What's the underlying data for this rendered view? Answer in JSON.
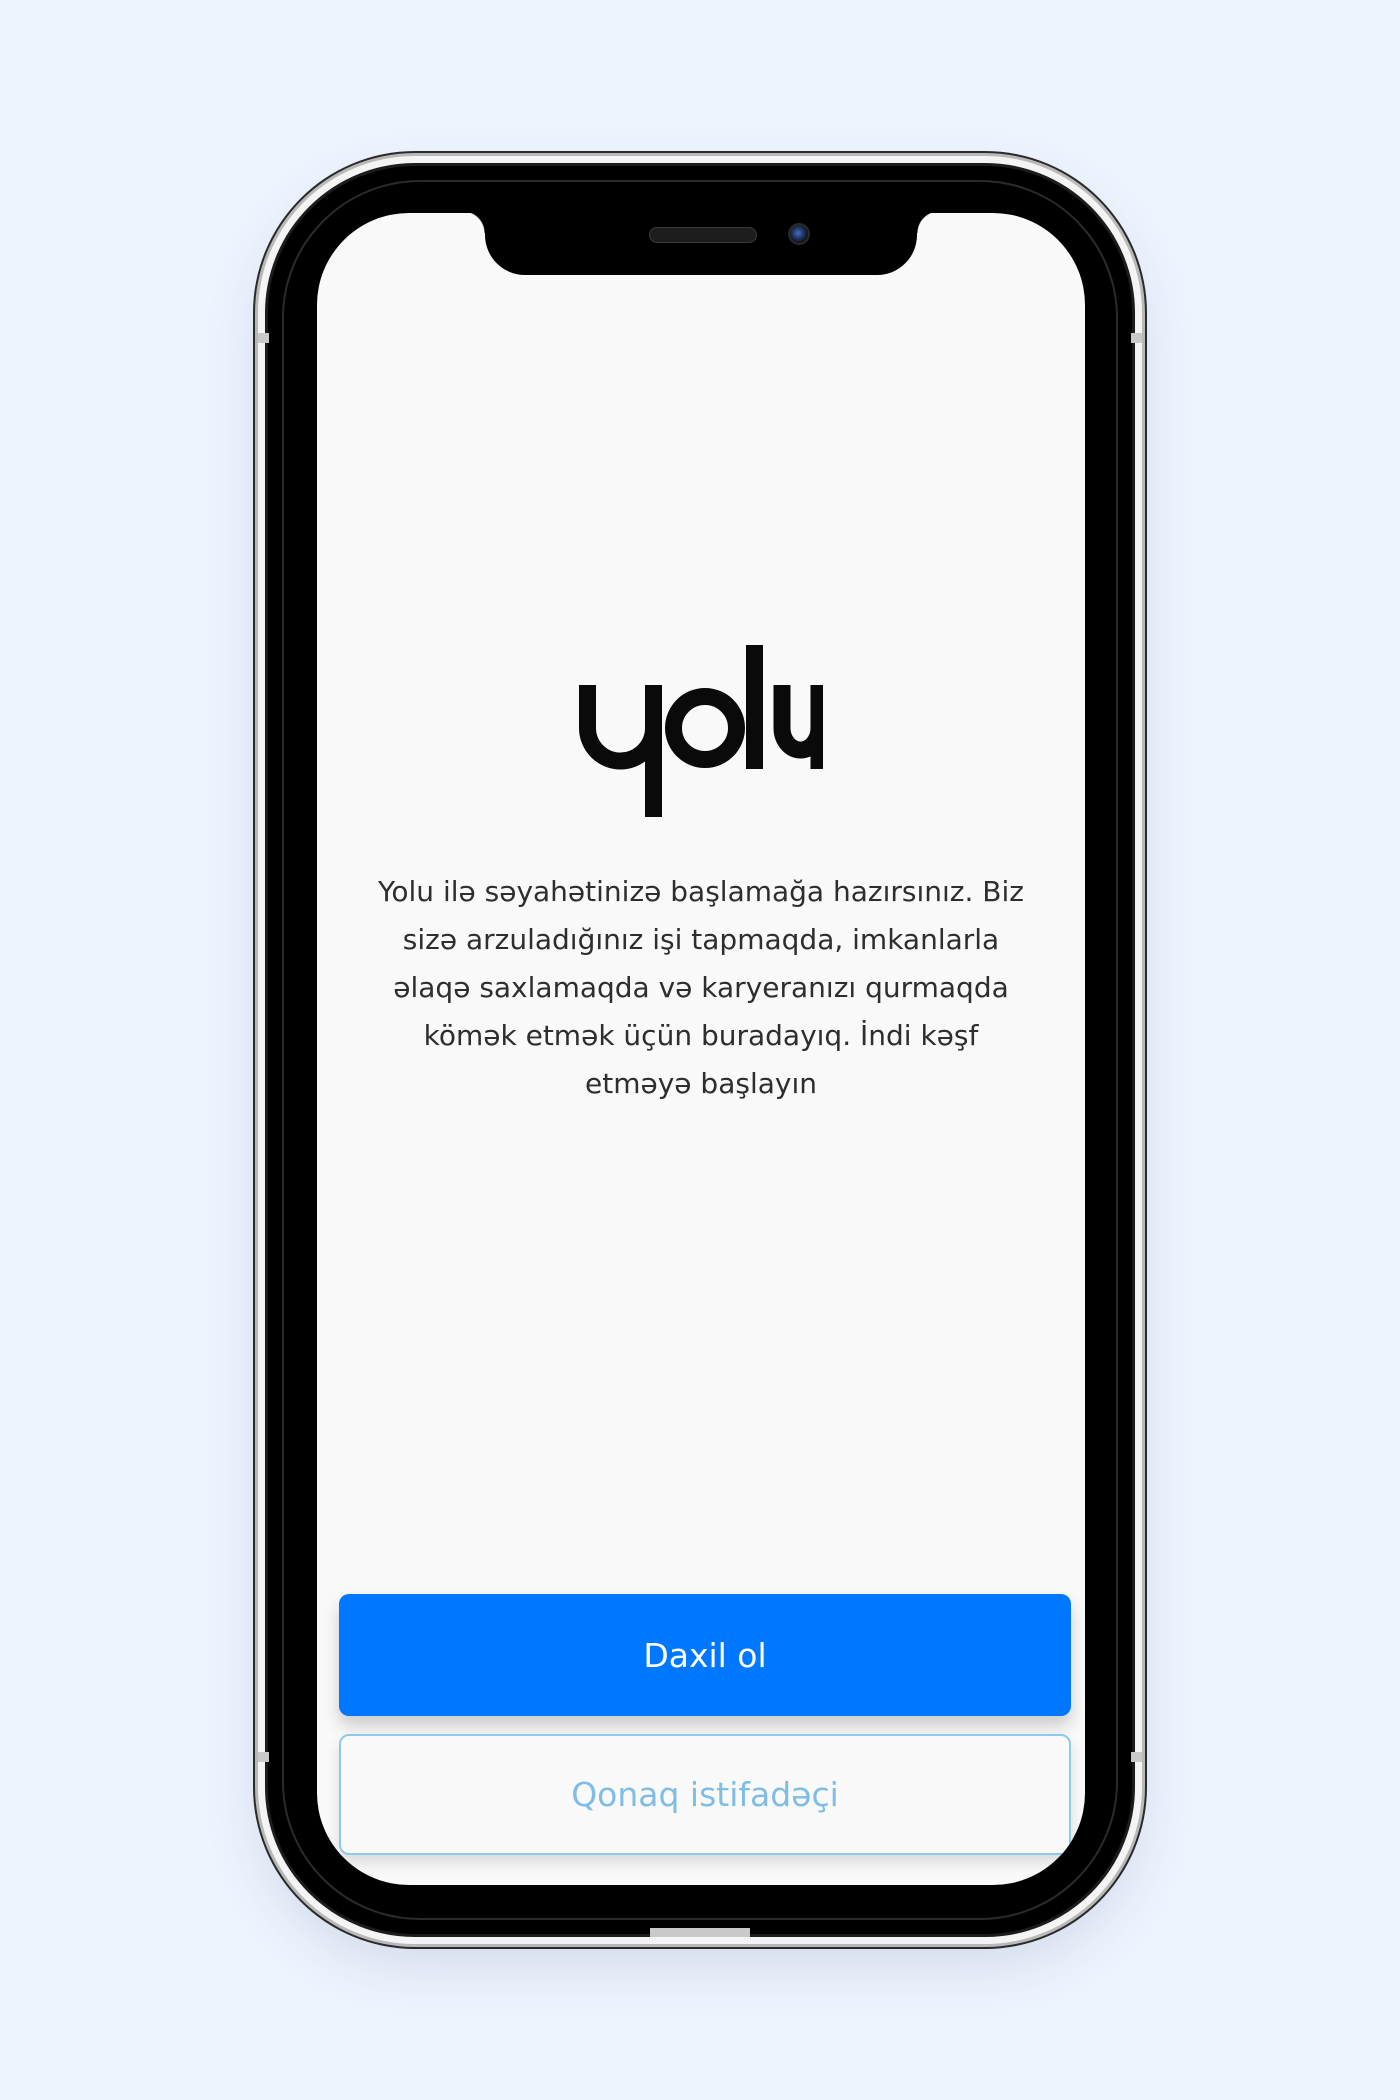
{
  "app": {
    "logo_text": "yolu"
  },
  "welcome": {
    "description": "Yolu ilə səyahətinizə başlamağa hazırsınız. Biz sizə arzuladığınız işi tapmaqda, imkanlarla əlaqə saxlamaqda və karyeranızı qurmaqda kömək etmək üçün buradayıq. İndi kəşf etməyə başlayın"
  },
  "actions": {
    "login_label": "Daxil ol",
    "guest_label": "Qonaq istifadəçi"
  },
  "colors": {
    "page_background": "#eef4fe",
    "screen_background": "#f9f9f9",
    "primary": "#0077ff",
    "secondary_text": "#7fbde6",
    "body_text": "#2e2e2e"
  }
}
